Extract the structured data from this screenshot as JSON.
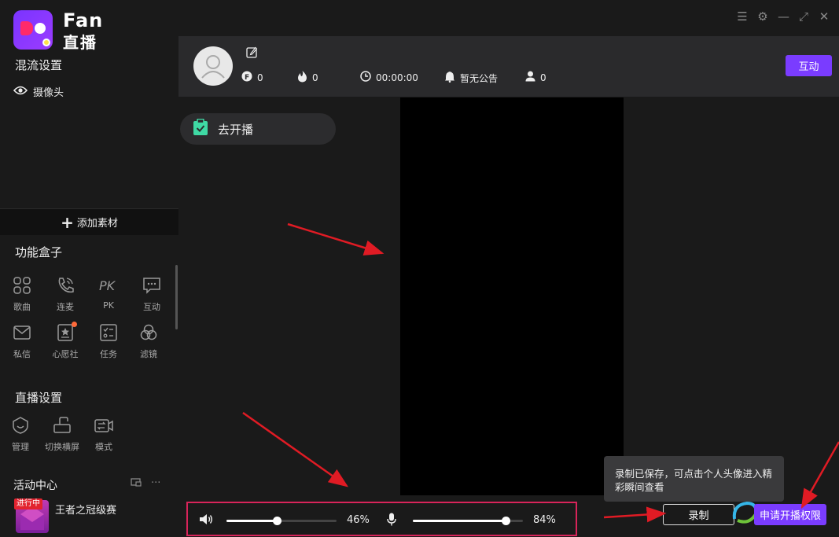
{
  "brand": {
    "line1": "Fan",
    "line2": "直播"
  },
  "sidebar": {
    "mix_title": "混流设置",
    "camera_label": "摄像头",
    "add_material": "添加素材",
    "function_box_title": "功能盒子",
    "tools": [
      {
        "label": "歌曲",
        "icon": "grid-icon"
      },
      {
        "label": "连麦",
        "icon": "phone-icon"
      },
      {
        "label": "PK",
        "icon": "pk-icon"
      },
      {
        "label": "互动",
        "icon": "chat-icon"
      },
      {
        "label": "私信",
        "icon": "mail-icon"
      },
      {
        "label": "心愿社",
        "icon": "star-card-icon"
      },
      {
        "label": "任务",
        "icon": "checklist-icon"
      },
      {
        "label": "滤镜",
        "icon": "filter-icon"
      }
    ],
    "live_settings_title": "直播设置",
    "settings": [
      {
        "label": "管理",
        "icon": "shield-icon"
      },
      {
        "label": "切换横屏",
        "icon": "rotate-icon"
      },
      {
        "label": "模式",
        "icon": "camera-switch-icon"
      }
    ],
    "activity_title": "活动中心",
    "event": {
      "tag": "进行中",
      "name": "王者之冠级赛"
    }
  },
  "header": {
    "stats": [
      {
        "icon": "coin-icon",
        "value": "0"
      },
      {
        "icon": "fire-icon",
        "value": "0"
      },
      {
        "icon": "clock-icon",
        "value": "00:00:00"
      },
      {
        "icon": "bell-icon",
        "value": "暂无公告"
      },
      {
        "icon": "user-icon",
        "value": "0"
      }
    ],
    "interact_button": "互动"
  },
  "main": {
    "go_live": "去开播",
    "toast": "录制已保存，可点击个人头像进入精彩瞬间查看",
    "speaker_volume": 46,
    "speaker_label": "46%",
    "mic_volume": 84,
    "mic_label": "84%",
    "record_button": "录制",
    "apply_button": "申请开播权限"
  },
  "colors": {
    "accent": "#7a3cff",
    "highlight_border": "#d8245a",
    "annotation_arrow": "#e01b24"
  }
}
